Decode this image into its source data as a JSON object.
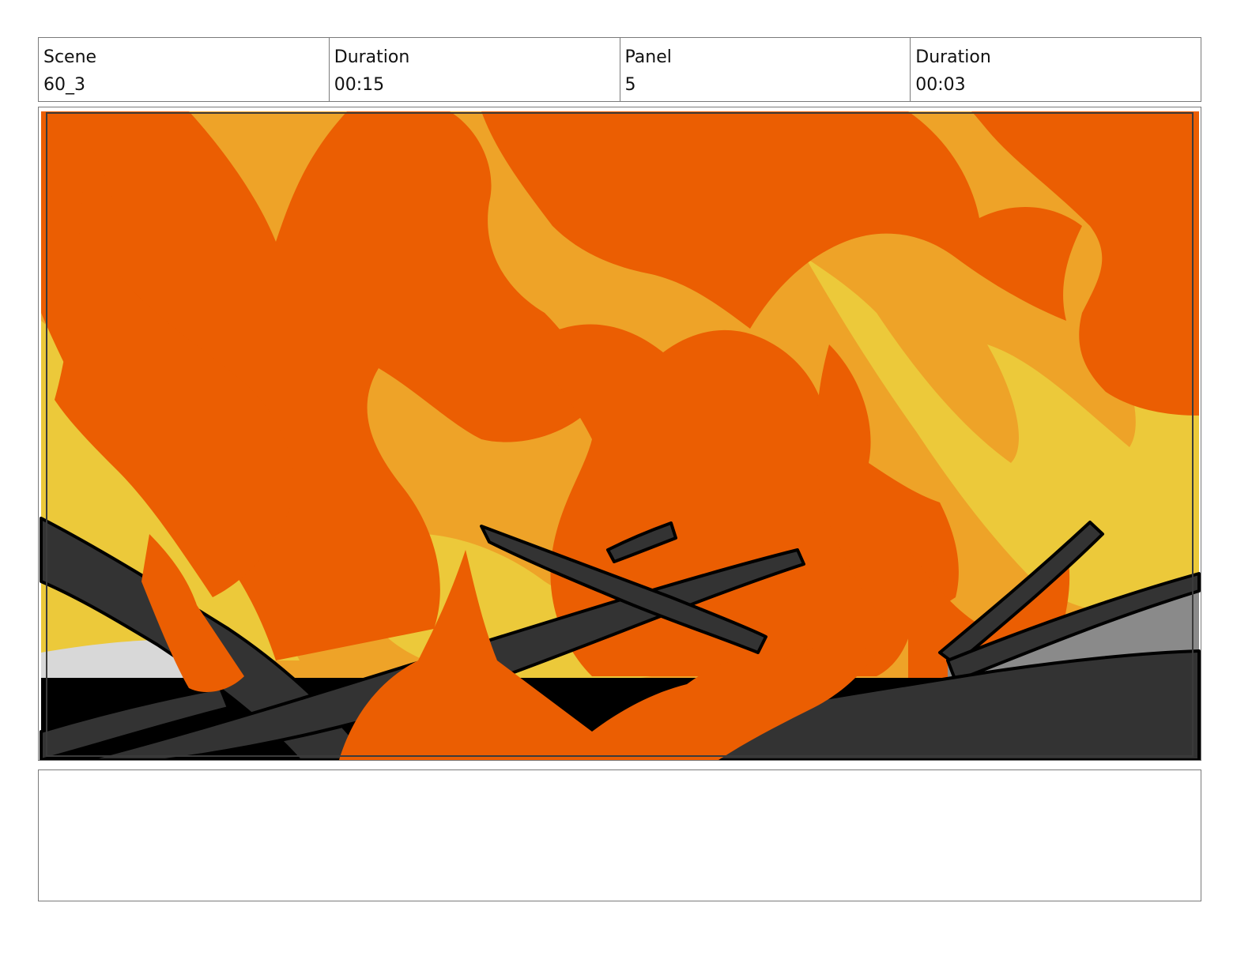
{
  "header": {
    "scene": {
      "label": "Scene",
      "value": "60_3"
    },
    "scene_duration": {
      "label": "Duration",
      "value": "00:15"
    },
    "panel": {
      "label": "Panel",
      "value": "5"
    },
    "panel_duration": {
      "label": "Duration",
      "value": "00:03"
    }
  },
  "notes": {
    "text": ""
  },
  "colors": {
    "flame_orange": "#eb5e02",
    "flame_amber": "#eea328",
    "flame_yellow": "#ecc93a",
    "beam_dark": "#333333",
    "ground_black": "#000000",
    "debris_gray": "#8a8a8a"
  }
}
